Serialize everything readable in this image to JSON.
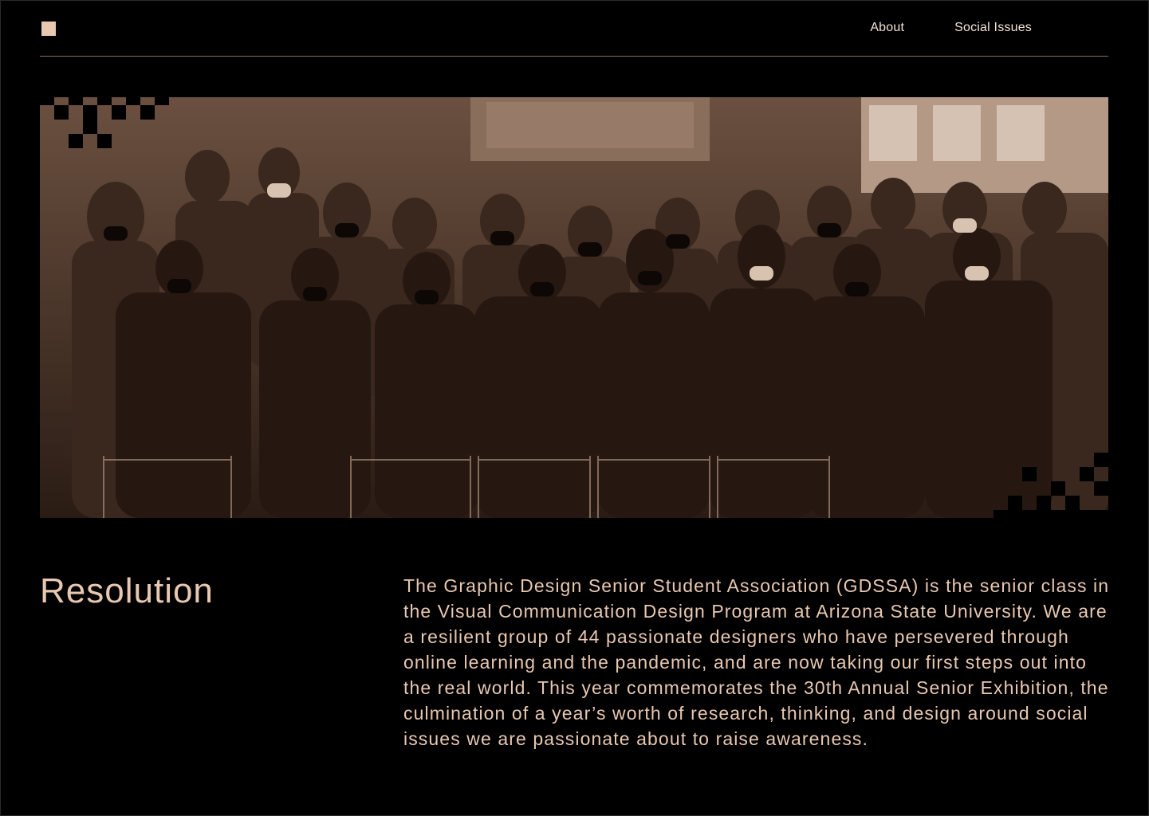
{
  "colors": {
    "accent": "#e8c8b0",
    "background": "#000000",
    "rule": "#8a6a56"
  },
  "header": {
    "logo_icon": "square-logo-icon",
    "nav": [
      {
        "label": "About"
      },
      {
        "label": "Social Issues"
      }
    ]
  },
  "hero": {
    "image_alt": "Sepia group photo of the GDSSA senior class seated and standing outdoors, wearing masks"
  },
  "content": {
    "heading": "Resolution",
    "paragraph": "The Graphic Design Senior Student Association (GDSSA) is the senior class in the Visual Communication Design Program at Arizona State University. We are a resilient group of 44 passionate designers who have persevered through online learning and the pandemic, and are now taking our first steps out into the real world. This year commemorates the 30th Annual Senior Exhibition, the culmination of a year’s worth of research, thinking, and design around social issues we are passionate about to raise awareness."
  }
}
